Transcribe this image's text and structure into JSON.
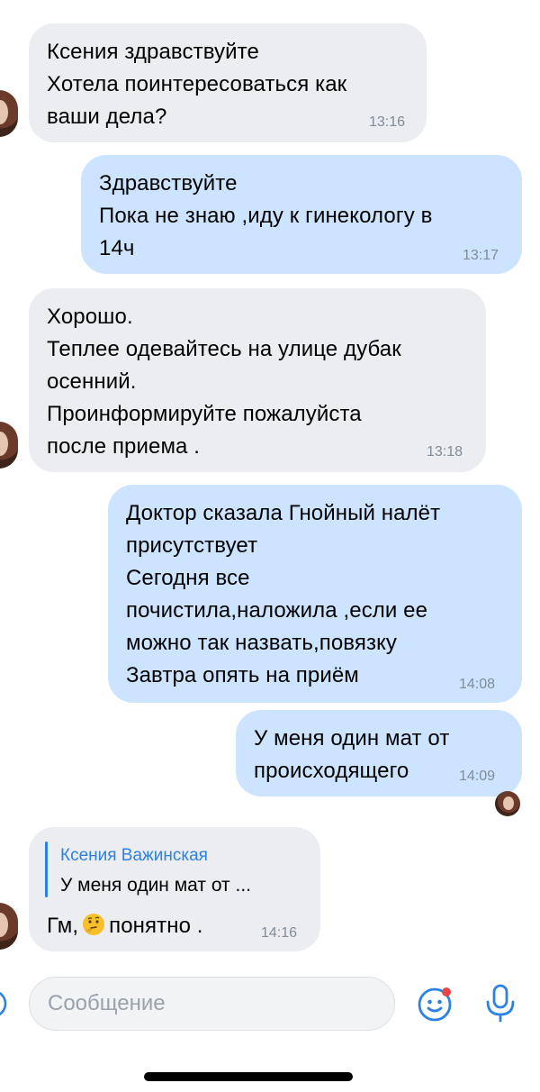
{
  "messages": [
    {
      "text": "Ксения здравствуйте\nХотела поинтересоваться как\nваши дела?",
      "time": "13:16",
      "direction": "incoming"
    },
    {
      "text": "Здравствуйте\nПока не знаю ,иду к гинекологу в\n14ч",
      "time": "13:17",
      "direction": "outgoing"
    },
    {
      "text": "Хорошо.\nТеплее одевайтесь на улице дубак\nосенний.\nПроинформируйте пожалуйста\nпосле приема .",
      "time": "13:18",
      "direction": "incoming"
    },
    {
      "text": "Доктор сказала Гнойный налёт\nприсутствует\nСегодня все\nпочистила,наложила ,если ее\nможно так назвать,повязку\nЗавтра опять на приём",
      "time": "14:08",
      "direction": "outgoing"
    },
    {
      "text": "У меня один мат от\nпроисходящего",
      "time": "14:09",
      "direction": "outgoing"
    },
    {
      "reply_author": "Ксения Важинская",
      "reply_text": "У меня один мат от ...",
      "text_before_emoji": "Гм,",
      "emoji": "thinking-face",
      "text_after_emoji": "понятно .",
      "time": "14:16",
      "direction": "incoming"
    }
  ],
  "composer": {
    "placeholder": "Сообщение",
    "left_icon": "attach-icon",
    "sticker_icon": "sticker-icon",
    "mic_icon": "microphone-icon",
    "accent_color": "#2d81e0",
    "badge_color": "#e64646"
  },
  "colors": {
    "incoming_bubble": "#ebedf0",
    "outgoing_bubble": "#cce4ff",
    "time_text": "#818c99"
  }
}
